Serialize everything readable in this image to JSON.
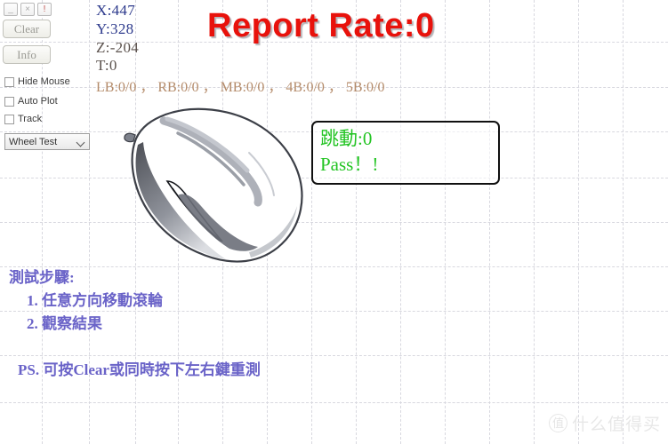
{
  "window_controls": [
    {
      "name": "minimize",
      "glyph": "_"
    },
    {
      "name": "close",
      "glyph": "×"
    },
    {
      "name": "info",
      "glyph": "!"
    }
  ],
  "toolbar": {
    "clear_label": "Clear",
    "info_label": "Info"
  },
  "options": [
    {
      "label": "Hide Mouse",
      "checked": false
    },
    {
      "label": "Auto Plot",
      "checked": false
    },
    {
      "label": "Track",
      "checked": false
    }
  ],
  "mode_select": {
    "selected": "Wheel Test",
    "icon": "chevron-down-icon"
  },
  "readout": {
    "x": "X:447",
    "y": "Y:328",
    "z": "Z:-204",
    "t": "T:0",
    "buttons": "LB:0/0 ， RB:0/0 ， MB:0/0 ， 4B:0/0 ， 5B:0/0"
  },
  "title": {
    "report_rate": "Report Rate:0",
    "color": "#e8120c"
  },
  "result": {
    "jitter_line": "跳動:0",
    "status_line": "Pass！!",
    "color": "#23c423"
  },
  "instructions": {
    "heading": "測試步驟:",
    "step1": "1. 任意方向移動滾輪",
    "step2": "2. 觀察結果",
    "ps": "PS. 可按Clear或同時按下左右鍵重測",
    "color": "#6a63c8"
  },
  "watermark": {
    "badge": "值",
    "text": "什么值得买"
  },
  "mouse_illustration": {
    "alt": "grayscale line art of a computer mouse"
  }
}
